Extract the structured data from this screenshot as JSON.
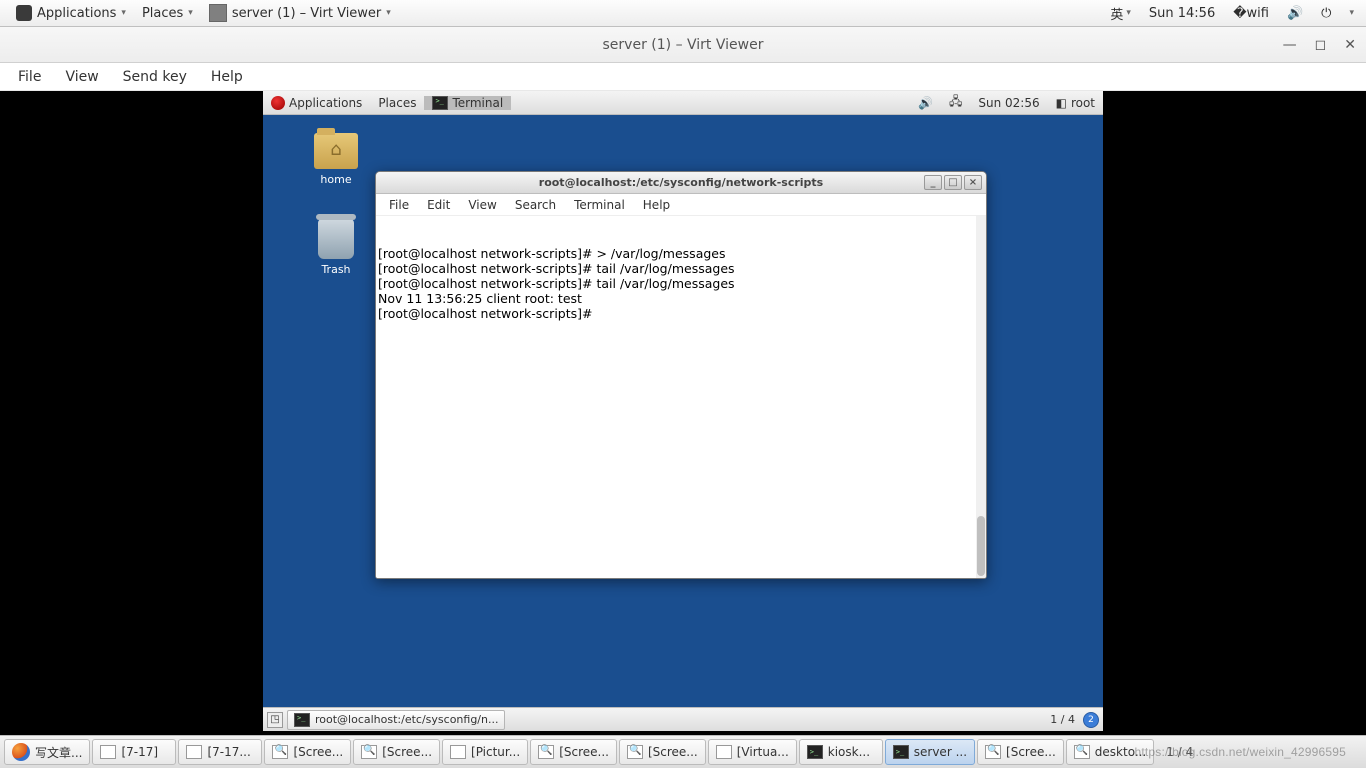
{
  "host_panel": {
    "applications": "Applications",
    "places": "Places",
    "active_window": "server (1) – Virt Viewer",
    "ime": "英",
    "clock": "Sun 14:56"
  },
  "virt_viewer": {
    "title": "server (1) – Virt Viewer",
    "menu": {
      "file": "File",
      "view": "View",
      "sendkey": "Send key",
      "help": "Help"
    }
  },
  "guest_panel": {
    "applications": "Applications",
    "places": "Places",
    "terminal": "Terminal",
    "clock": "Sun 02:56",
    "user": "root"
  },
  "desktop": {
    "home": "home",
    "trash": "Trash"
  },
  "terminal": {
    "title": "root@localhost:/etc/sysconfig/network-scripts",
    "menu": {
      "file": "File",
      "edit": "Edit",
      "view": "View",
      "search": "Search",
      "terminal": "Terminal",
      "help": "Help"
    },
    "lines": [
      "[root@localhost network-scripts]# > /var/log/messages",
      "[root@localhost network-scripts]# tail /var/log/messages",
      "[root@localhost network-scripts]# tail /var/log/messages",
      "Nov 11 13:56:25 client root: test",
      "[root@localhost network-scripts]# "
    ]
  },
  "guest_bottom": {
    "task": "root@localhost:/etc/sysconfig/n...",
    "workspace": "1 / 4",
    "badge": "2"
  },
  "host_taskbar": {
    "items": [
      {
        "label": "写文章...",
        "icon": "ff"
      },
      {
        "label": "[7-17]",
        "icon": "doc"
      },
      {
        "label": "[7-17...",
        "icon": "doc"
      },
      {
        "label": "[Scree...",
        "icon": "mag"
      },
      {
        "label": "[Scree...",
        "icon": "mag"
      },
      {
        "label": "[Pictur...",
        "icon": "doc"
      },
      {
        "label": "[Scree...",
        "icon": "mag"
      },
      {
        "label": "[Scree...",
        "icon": "mag"
      },
      {
        "label": "[Virtua...",
        "icon": "vb"
      },
      {
        "label": "kiosk...",
        "icon": "term"
      },
      {
        "label": "server ...",
        "icon": "term",
        "active": true
      },
      {
        "label": "[Scree...",
        "icon": "mag"
      },
      {
        "label": "deskto...",
        "icon": "mag"
      }
    ],
    "pager": "1 / 4"
  },
  "watermark": "https://blog.csdn.net/weixin_42996595"
}
